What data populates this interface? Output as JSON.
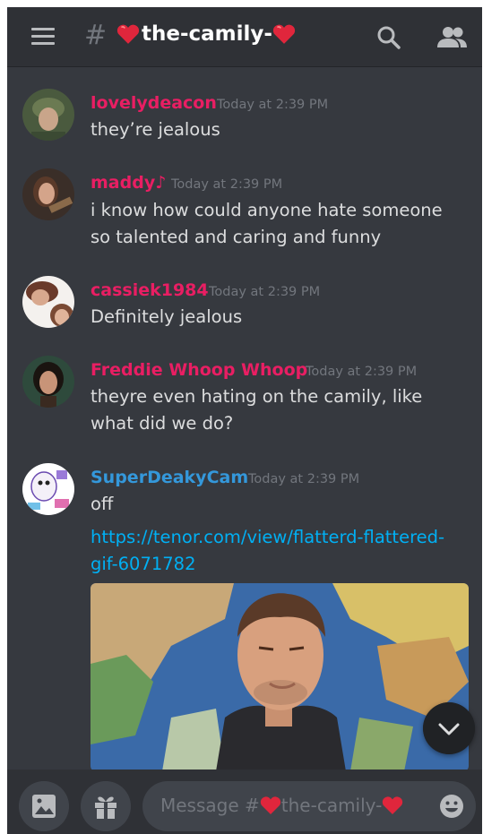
{
  "header": {
    "hash": "#",
    "channel_name": "the-camily-"
  },
  "messages": [
    {
      "username": "lovelydeacon",
      "username_color": "#e91e63",
      "timestamp": "Today at 2:39 PM",
      "text": "they’re jealous"
    },
    {
      "username": "maddy♪",
      "username_color": "#e91e63",
      "timestamp": "Today at 2:39 PM",
      "text": "i know how could anyone hate someone so talented and caring and funny"
    },
    {
      "username": "cassiek1984",
      "username_color": "#e91e63",
      "timestamp": "Today at 2:39 PM",
      "text": "Definitely jealous"
    },
    {
      "username": "Freddie Whoop Whoop",
      "username_color": "#e91e63",
      "timestamp": "Today at 2:39 PM",
      "text": "theyre even hating on the camily, like what did we do?"
    },
    {
      "username": "SuperDeakyCam",
      "username_color": "#3498db",
      "timestamp": "Today at 2:39 PM",
      "text": "off",
      "link": "https://tenor.com/view/flatterd-flattered-gif-6071782"
    }
  ],
  "composer": {
    "placeholder_prefix": "Message #",
    "placeholder_channel": "the-camily-"
  },
  "icons": {
    "menu": "hamburger-icon",
    "search": "search-icon",
    "members": "members-icon",
    "image": "image-icon",
    "gift": "gift-icon",
    "emoji": "emoji-icon",
    "scroll": "chevron-down-icon"
  },
  "colors": {
    "background": "#36393f",
    "header": "#2f3136",
    "text": "#dcddde",
    "muted": "#72767d",
    "link": "#00b0f4"
  }
}
